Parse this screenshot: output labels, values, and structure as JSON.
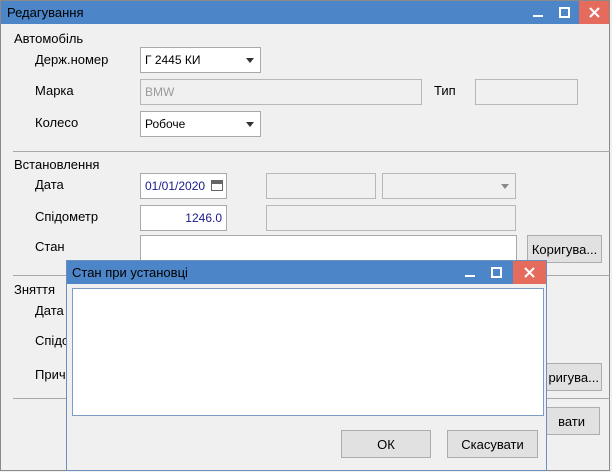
{
  "main_window": {
    "title": "Редагування",
    "controls": {
      "minimize": "minimize-icon",
      "maximize": "maximize-icon",
      "close": "close-icon"
    }
  },
  "car_section": {
    "title": "Автомобіль",
    "reg_number_label": "Держ.номер",
    "reg_number_value": "Г 2445 КИ",
    "brand_label": "Марка",
    "brand_value": "BMW",
    "type_label": "Тип",
    "type_value": "",
    "wheel_label": "Колесо",
    "wheel_value": "Робоче"
  },
  "install_section": {
    "title": "Встановлення",
    "date_label": "Дата",
    "date_value": "01/01/2020",
    "odometer_label": "Спідометр",
    "odometer_value": "1246.0",
    "state_label": "Стан",
    "state_value": "",
    "edit_button": "Коригува..."
  },
  "removal_section": {
    "title": "Зняття",
    "date_label": "Дата",
    "odometer_label": "Спідо",
    "reason_label": "Прич",
    "edit_button": "ригува...",
    "cancel_button": "вати"
  },
  "dialog": {
    "title": "Стан при установці",
    "memo_value": "",
    "ok_button": "ОК",
    "cancel_button": "Скасувати"
  }
}
